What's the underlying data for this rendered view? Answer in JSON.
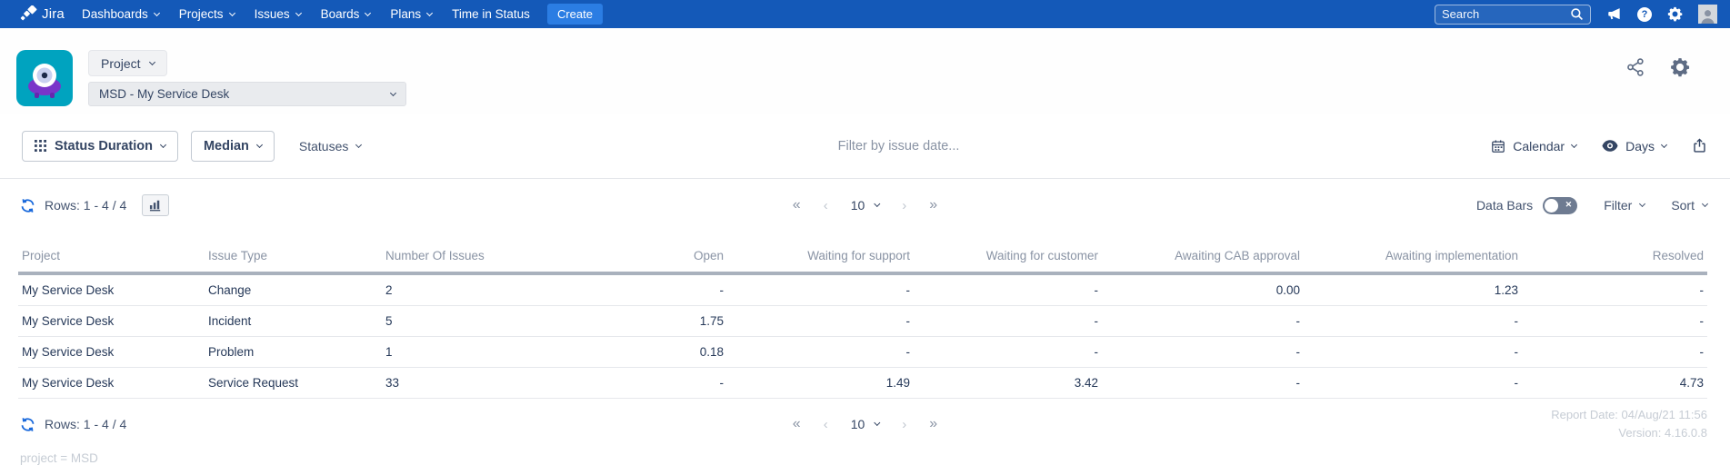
{
  "colors": {
    "navbar": "#1459b8",
    "create_button": "#2b7de3",
    "refresh_blue": "#1868db",
    "toggle_off": "#6e7b91",
    "project_tile": "#00a3bf",
    "header_rule": "#a9b1bd",
    "muted_text": "#8993a4",
    "faint_text": "#c6ccd4"
  },
  "nav": {
    "logo_text": "Jira",
    "items": [
      "Dashboards",
      "Projects",
      "Issues",
      "Boards",
      "Plans",
      "Time in Status"
    ],
    "create_label": "Create",
    "search_placeholder": "Search"
  },
  "header": {
    "scope_label": "Project",
    "project_value": "MSD - My Service Desk"
  },
  "toolbar": {
    "report_type_label": "Status Duration",
    "metric_label": "Median",
    "statuses_label": "Statuses",
    "date_filter_placeholder": "Filter by issue date...",
    "calendar_label": "Calendar",
    "unit_label": "Days"
  },
  "controls": {
    "rows_label": "Rows: 1 - 4 / 4",
    "pager": {
      "first": "«",
      "prev": "‹",
      "size": "10",
      "next": "›",
      "last": "»"
    },
    "data_bars_label": "Data Bars",
    "filter_label": "Filter",
    "sort_label": "Sort"
  },
  "table": {
    "columns": [
      "Project",
      "Issue Type",
      "Number Of Issues",
      "Open",
      "Waiting for support",
      "Waiting for customer",
      "Awaiting CAB approval",
      "Awaiting implementation",
      "Resolved"
    ],
    "rows": [
      [
        "My Service Desk",
        "Change",
        "2",
        "-",
        "-",
        "-",
        "0.00",
        "1.23",
        "-"
      ],
      [
        "My Service Desk",
        "Incident",
        "5",
        "1.75",
        "-",
        "-",
        "-",
        "-",
        "-"
      ],
      [
        "My Service Desk",
        "Problem",
        "1",
        "0.18",
        "-",
        "-",
        "-",
        "-",
        "-"
      ],
      [
        "My Service Desk",
        "Service Request",
        "33",
        "-",
        "1.49",
        "3.42",
        "-",
        "-",
        "4.73"
      ]
    ]
  },
  "footer": {
    "rows_label": "Rows: 1 - 4 / 4",
    "report_date": "Report Date: 04/Aug/21 11:56",
    "version": "Version: 4.16.0.8",
    "jql": "project = MSD"
  }
}
